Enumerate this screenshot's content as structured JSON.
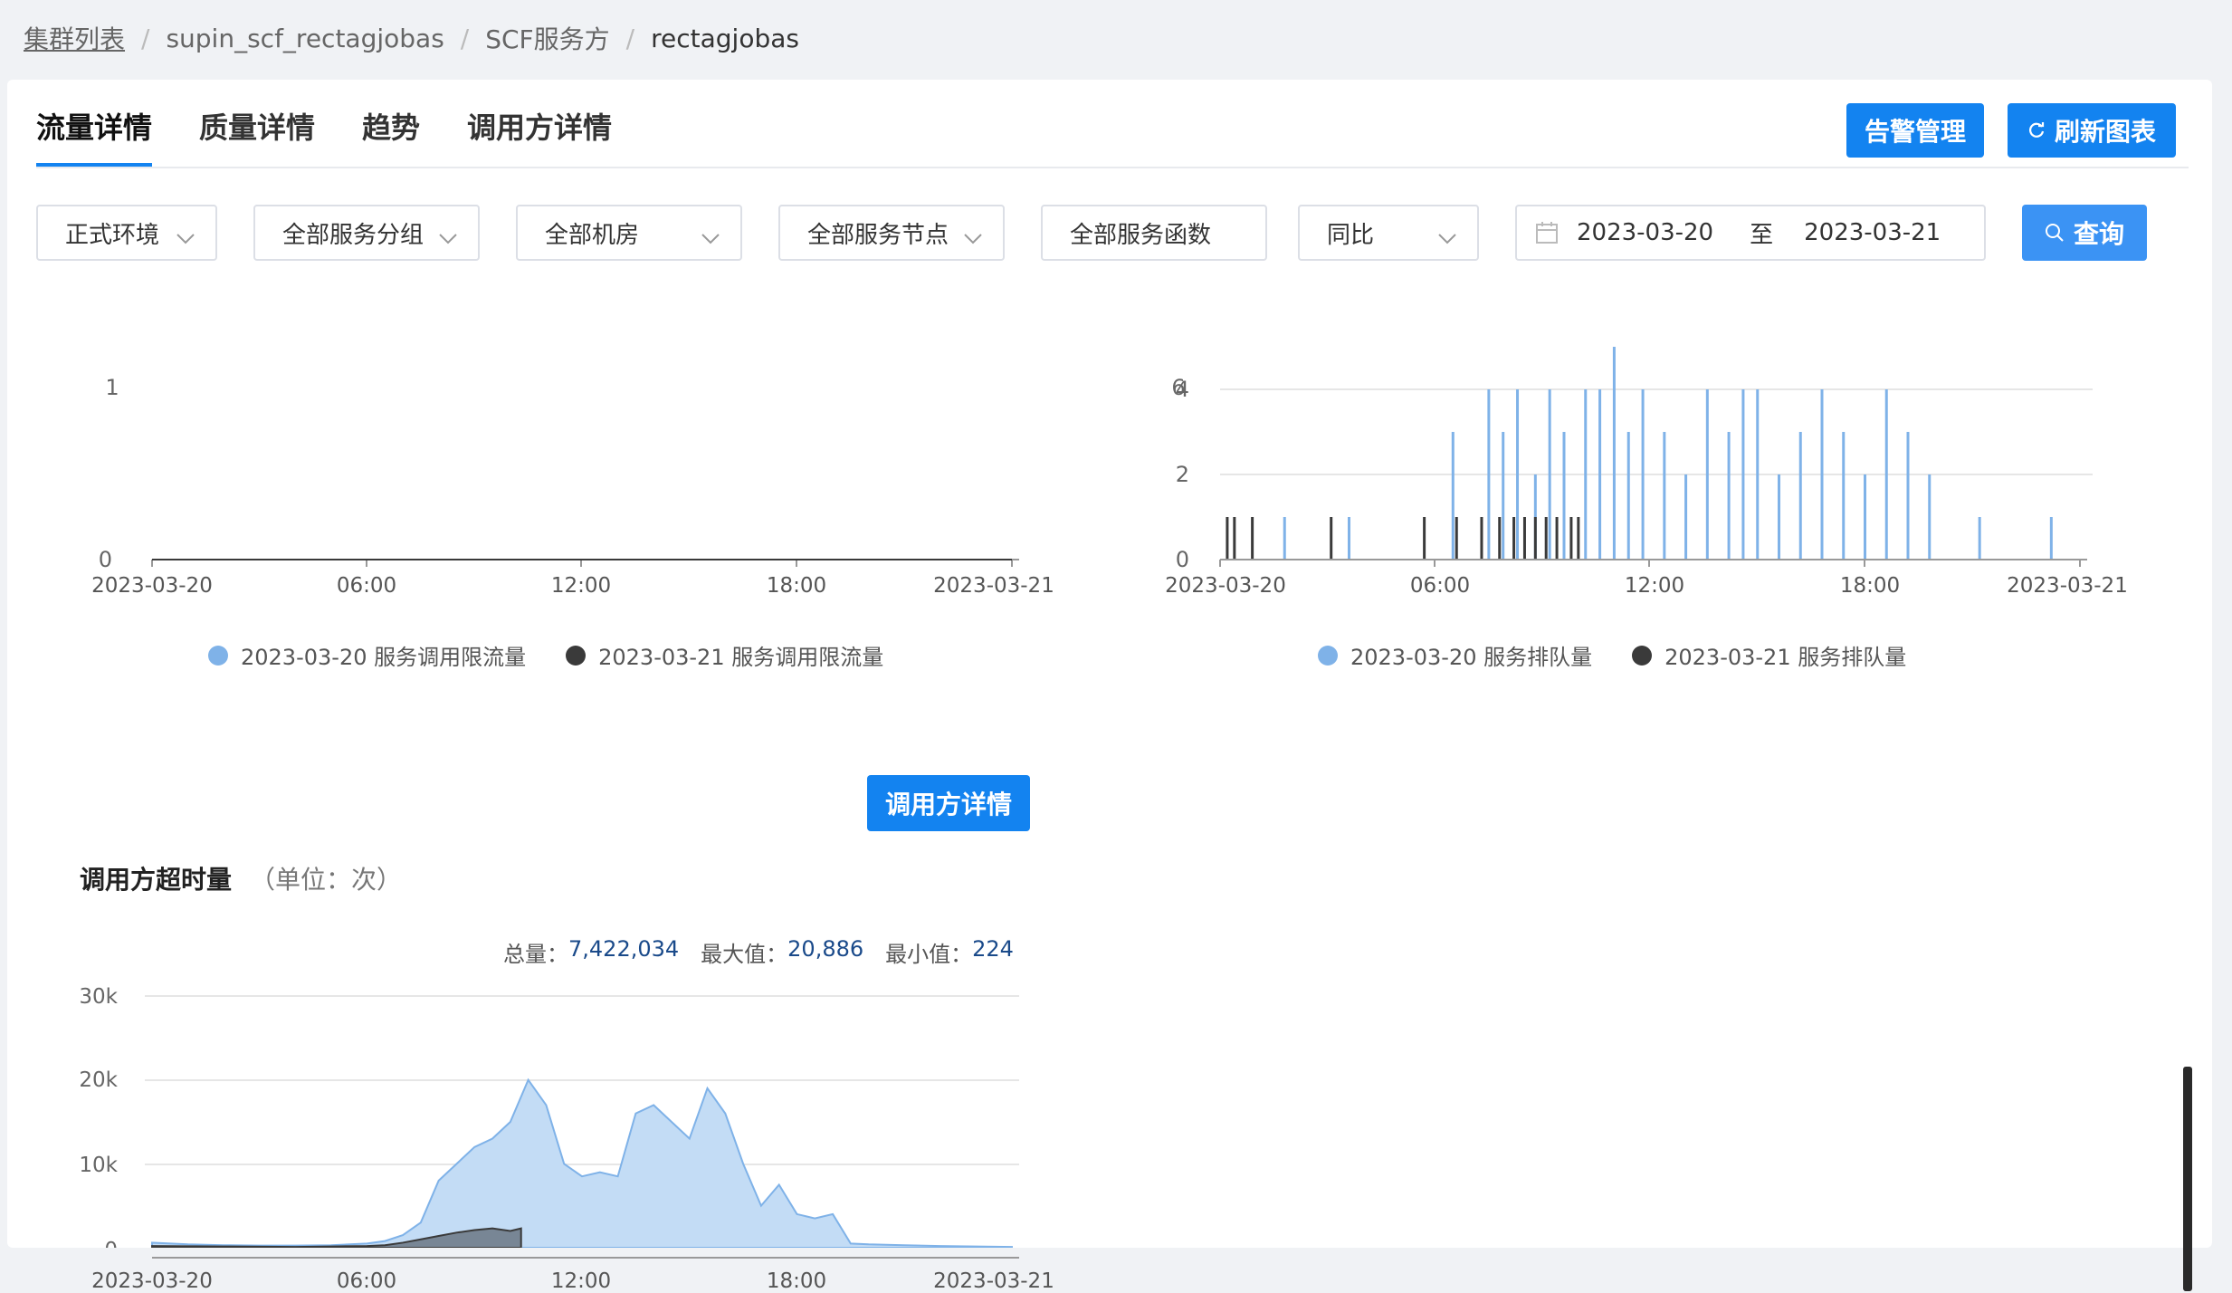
{
  "breadcrumb": {
    "items": [
      "集群列表",
      "supin_scf_rectagjobas",
      "SCF服务方",
      "rectagjobas"
    ],
    "separator": "/"
  },
  "tabs": [
    "流量详情",
    "质量详情",
    "趋势",
    "调用方详情"
  ],
  "toolbar": {
    "alarm_label": "告警管理",
    "refresh_label": "刷新图表"
  },
  "filters": {
    "env": "正式环境",
    "group": "全部服务分组",
    "room": "全部机房",
    "node": "全部服务节点",
    "func": "全部服务函数",
    "compare": "同比",
    "date_start": "2023-03-20",
    "date_sep": "至",
    "date_end": "2023-03-21",
    "query_label": "查询"
  },
  "colors": {
    "primary": "#1383f0",
    "series_a": "#7fb2e8",
    "series_b": "#3a3a3a"
  },
  "charts": {
    "x_ticks": [
      "2023-03-20",
      "06:00",
      "12:00",
      "18:00",
      "2023-03-21"
    ],
    "limit_flow": {
      "y_ticks": [
        "0"
      ],
      "y_top_partial": "1",
      "legend": [
        "2023-03-20 服务调用限流量",
        "2023-03-21 服务调用限流量"
      ]
    },
    "queue": {
      "y_ticks": [
        "0",
        "2",
        "4"
      ],
      "y_top_partial": "6",
      "legend": [
        "2023-03-20 服务排队量",
        "2023-03-21 服务排队量"
      ]
    },
    "timeout": {
      "title": "调用方超时量",
      "unit": "（单位：次）",
      "detail_button": "调用方详情",
      "stats": {
        "total_label": "总量：",
        "total": "7,422,034",
        "max_label": "最大值：",
        "max": "20,886",
        "min_label": "最小值：",
        "min": "224"
      },
      "y_ticks": [
        "0",
        "10k",
        "20k",
        "30k"
      ]
    }
  },
  "chart_data": [
    {
      "type": "line",
      "ylim": [
        0,
        1
      ],
      "series": [
        {
          "name": "2023-03-20 服务调用限流量",
          "values": [
            0,
            0,
            0,
            0,
            0
          ]
        },
        {
          "name": "2023-03-21 服务调用限流量",
          "values": [
            0,
            0,
            0,
            0,
            0
          ]
        }
      ]
    },
    {
      "type": "bar",
      "ylim": [
        0,
        6
      ],
      "series": [
        {
          "name": "2023-03-20 服务排队量",
          "x_hours": [
            1.8,
            3.6,
            6.5,
            7.5,
            7.9,
            8.3,
            8.8,
            9.2,
            9.6,
            10.2,
            10.6,
            11.0,
            11.4,
            11.8,
            12.4,
            13.0,
            13.6,
            14.2,
            14.6,
            15.0,
            15.6,
            16.2,
            16.8,
            17.4,
            18.0,
            18.6,
            19.2,
            19.8,
            21.2,
            23.2
          ],
          "values": [
            1,
            1,
            3,
            4,
            3,
            4,
            2,
            4,
            3,
            4,
            4,
            5,
            3,
            4,
            3,
            2,
            4,
            3,
            4,
            4,
            2,
            3,
            4,
            3,
            2,
            4,
            3,
            2,
            1,
            1
          ]
        },
        {
          "name": "2023-03-21 服务排队量",
          "x_hours": [
            0.2,
            0.4,
            0.9,
            3.1,
            5.7,
            6.6,
            7.3,
            7.8,
            8.2,
            8.5,
            8.8,
            9.1,
            9.4,
            9.8,
            10.0
          ],
          "values": [
            1,
            1,
            1,
            1,
            1,
            1,
            1,
            1,
            1,
            1,
            1,
            1,
            1,
            1,
            1
          ]
        }
      ]
    },
    {
      "type": "area",
      "ylim": [
        0,
        30000
      ],
      "x_hours": [
        0,
        1,
        2,
        3,
        4,
        5,
        6,
        6.5,
        7,
        7.5,
        8,
        8.5,
        9,
        9.5,
        10,
        10.5,
        11,
        11.5,
        12,
        12.5,
        13,
        13.5,
        14,
        14.5,
        15,
        15.5,
        16,
        16.5,
        17,
        17.5,
        18,
        18.5,
        19,
        19.5,
        20,
        21,
        22,
        23,
        24
      ],
      "series": [
        {
          "name": "2023-03-20",
          "values": [
            600,
            400,
            300,
            250,
            250,
            300,
            500,
            800,
            1500,
            3000,
            8000,
            10000,
            12000,
            13000,
            15000,
            20000,
            17000,
            10000,
            8500,
            9000,
            8500,
            16000,
            17000,
            15000,
            13000,
            19000,
            16000,
            10000,
            5000,
            7500,
            4000,
            3500,
            4000,
            500,
            400,
            300,
            200,
            150,
            100
          ]
        },
        {
          "name": "2023-03-21",
          "x_hours": [
            0,
            2,
            4,
            5,
            6,
            6.5,
            7,
            7.5,
            8,
            8.5,
            9,
            9.5,
            10,
            10.3
          ],
          "values": [
            200,
            150,
            100,
            150,
            200,
            300,
            600,
            1000,
            1400,
            1800,
            2100,
            2300,
            2000,
            2300
          ]
        }
      ]
    }
  ]
}
